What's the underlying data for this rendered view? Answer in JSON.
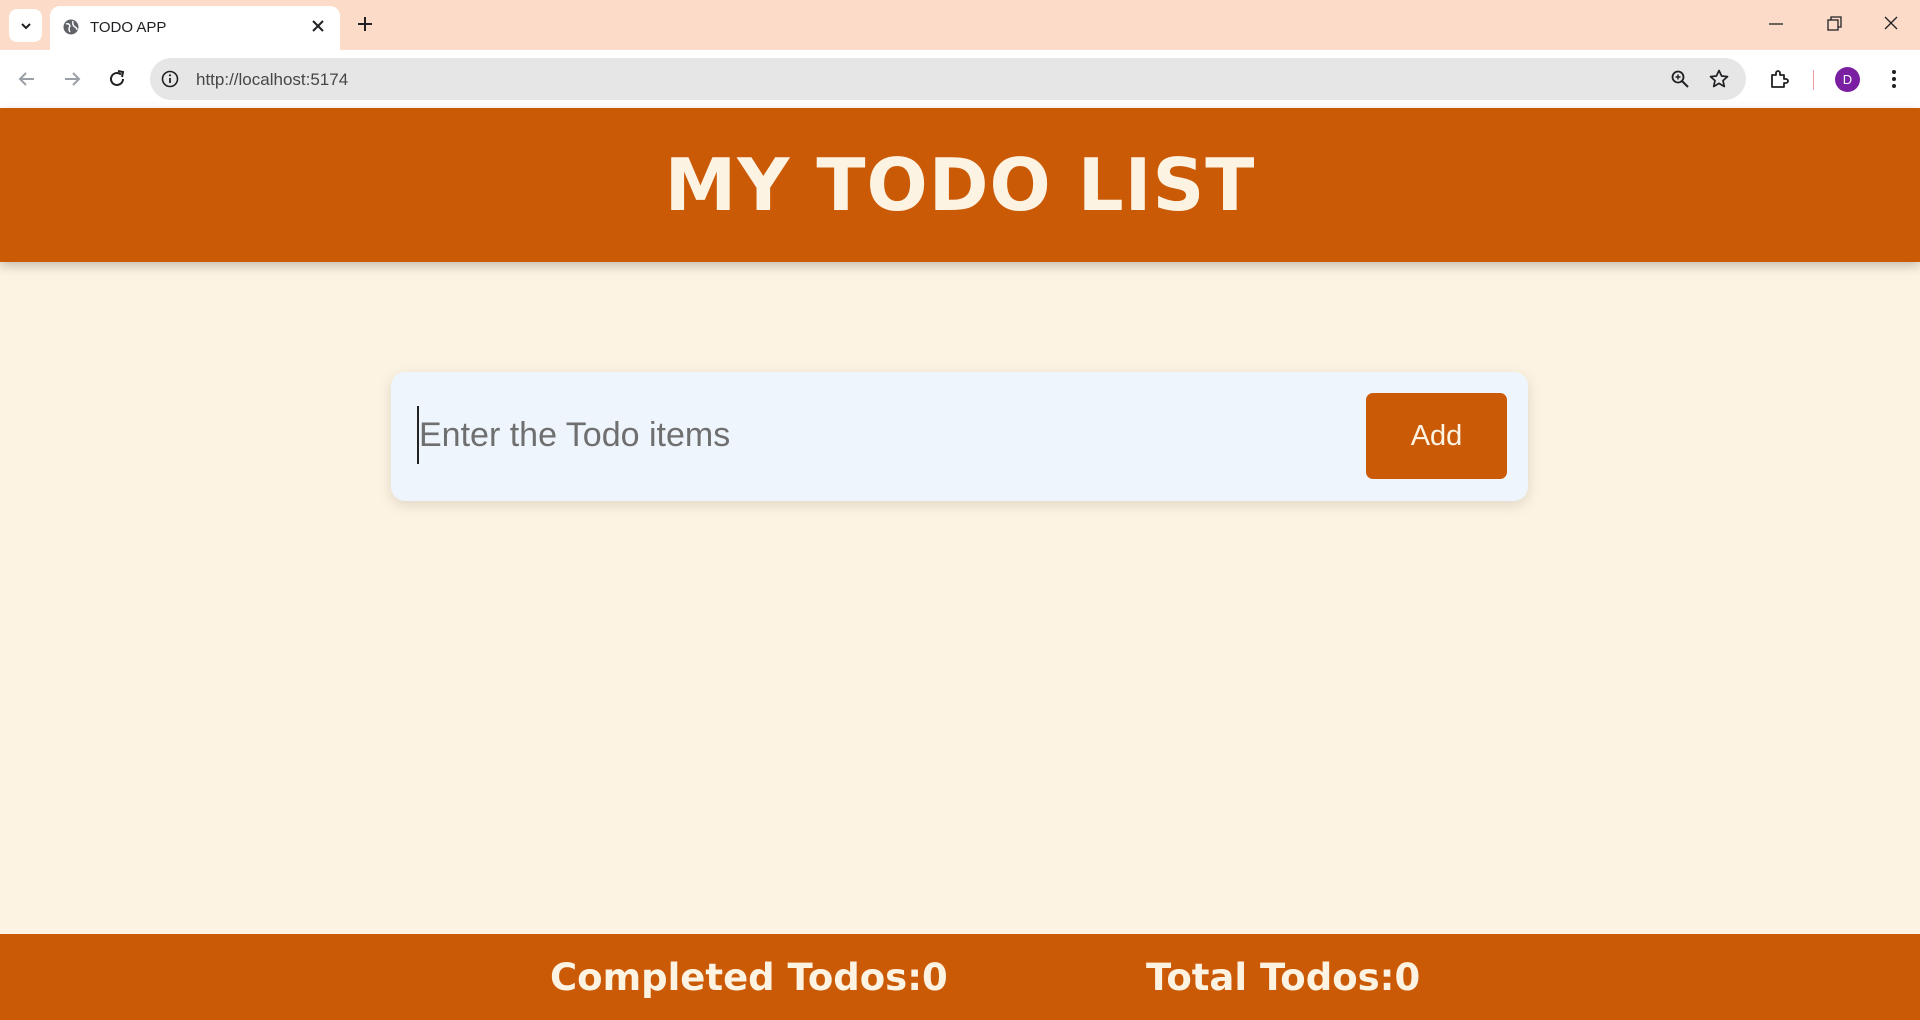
{
  "browser": {
    "tab_title": "TODO APP",
    "url": "http://localhost:5174",
    "profile_initial": "D"
  },
  "app": {
    "title": "MY TODO LIST",
    "input_placeholder": "Enter the Todo items",
    "input_value": "",
    "add_label": "Add",
    "completed_label": "Completed Todos:",
    "completed_count": "0",
    "total_label": "Total Todos:",
    "total_count": "0"
  },
  "colors": {
    "primary": "#cb5a07",
    "background": "#fdf3e2",
    "card": "#eef5fd",
    "tabstrip": "#fddbc9"
  }
}
